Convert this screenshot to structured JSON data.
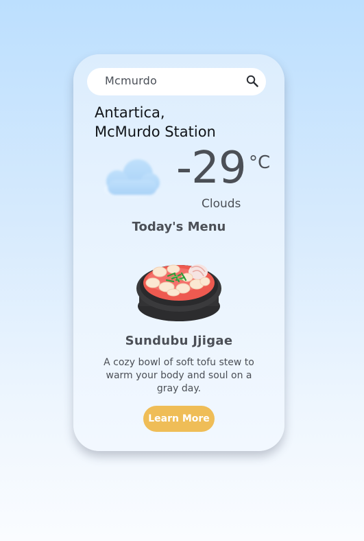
{
  "search": {
    "value": "Mcmurdo",
    "icon": "search-icon"
  },
  "location": {
    "line1": "Antartica,",
    "line2": "McMurdo Station"
  },
  "weather": {
    "temperature": "-29",
    "unit": "°C",
    "condition": "Clouds",
    "icon": "cloud-icon"
  },
  "menu": {
    "heading": "Today's Menu",
    "dish_name": "Sundubu Jjigae",
    "description": "A cozy bowl of soft tofu stew to warm your body and soul on a gray day.",
    "button_label": "Learn More",
    "button_color": "#efbd57"
  }
}
